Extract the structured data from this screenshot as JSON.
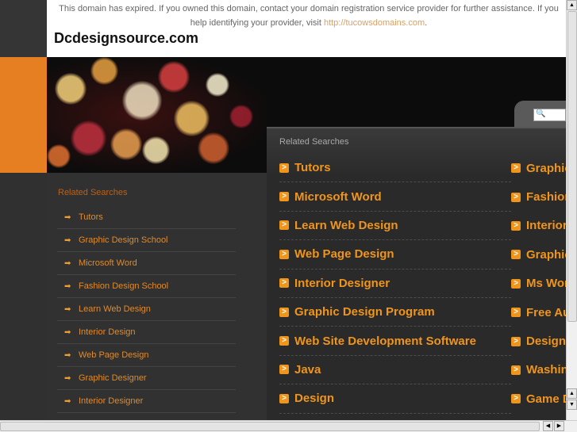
{
  "notice": {
    "line1": "This domain has expired. If you owned this domain, contact your domain registration service provider for further assistance. If you",
    "line2_prefix": "help identifying your provider, visit ",
    "link": "http://tucowsdomains.com",
    "line2_suffix": "."
  },
  "site_title": "Dcdesignsource.com",
  "search": {
    "icon": "search-icon",
    "value": ""
  },
  "sidebar": {
    "heading": "Related Searches",
    "items": [
      "Tutors",
      "Graphic Design School",
      "Microsoft Word",
      "Fashion Design School",
      "Learn Web Design",
      "Interior Design",
      "Web Page Design",
      "Graphic Designer",
      "Interior Designer"
    ]
  },
  "main": {
    "heading": "Related Searches",
    "col1": [
      "Tutors",
      "Microsoft Word",
      "Learn Web Design",
      "Web Page Design",
      "Interior Designer",
      "Graphic Design Program",
      "Web Site Development Software",
      "Java",
      "Design"
    ],
    "col2": [
      "Graphic",
      "Fashion",
      "Interior",
      "Graphic",
      "Ms Wor",
      "Free Au",
      "Design",
      "Washin",
      "Game D"
    ]
  },
  "colors": {
    "accent": "#f0951c",
    "orange_strip": "#e67e22"
  }
}
